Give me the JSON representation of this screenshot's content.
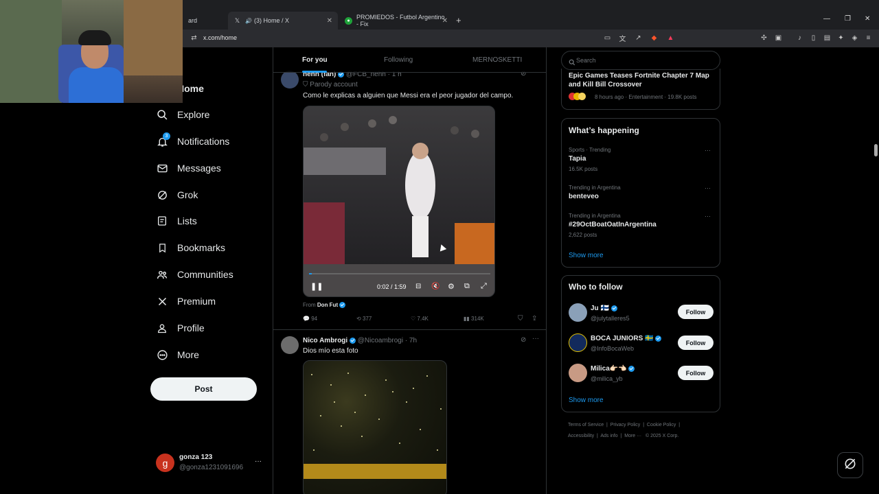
{
  "browser": {
    "tabs": [
      {
        "label": "ard",
        "icon": "page-icon"
      },
      {
        "label": "(3) Home / X",
        "icon": "x-logo-icon",
        "close": "✕"
      },
      {
        "label": "PROMIEDOS - Futbol Argentino - Fix",
        "icon": "promiedos-icon",
        "close": "✕"
      }
    ],
    "new_tab": "+",
    "url": "x.com/home"
  },
  "nav": {
    "items": [
      {
        "label": "Home",
        "icon": "home-icon"
      },
      {
        "label": "Explore",
        "icon": "search-icon"
      },
      {
        "label": "Notifications",
        "icon": "bell-icon",
        "badge": "3"
      },
      {
        "label": "Messages",
        "icon": "mail-icon"
      },
      {
        "label": "Grok",
        "icon": "grok-icon"
      },
      {
        "label": "Lists",
        "icon": "list-icon"
      },
      {
        "label": "Bookmarks",
        "icon": "bookmark-icon"
      },
      {
        "label": "Communities",
        "icon": "people-icon"
      },
      {
        "label": "Premium",
        "icon": "x-logo-icon"
      },
      {
        "label": "Profile",
        "icon": "person-icon"
      },
      {
        "label": "More",
        "icon": "more-circle-icon"
      }
    ],
    "post_label": "Post",
    "user": {
      "avatar_letter": "g",
      "name": "gonza 123",
      "handle": "@gonza1231091696",
      "menu": "···"
    }
  },
  "feed": {
    "tabs": [
      "For you",
      "Following",
      "MERNOSKETTI"
    ],
    "posts": [
      {
        "name": "nehh (fan)",
        "handle": "@FCB_nehh",
        "time": "· 1 h",
        "badge": "Parody account",
        "text": "Como le explicas a alguien que Messi era el peor jugador del campo.",
        "video_time": "0:02 / 1:59",
        "from_label": "From",
        "from_name": "Don Fut",
        "stats": {
          "replies": "94",
          "reposts": "377",
          "likes": "7.4K",
          "views": "314K"
        }
      },
      {
        "name": "Nico Ambrogi",
        "handle": "@Nicoambrogi",
        "time": "· 7h",
        "text": "Dios mío esta foto"
      }
    ]
  },
  "sidebar": {
    "search_placeholder": "Search",
    "top_news": {
      "headline": "Epic Games Teases Fortnite Chapter 7 Map and Kill Bill Crossover",
      "meta": "8 hours ago · Entertainment · 19.8K posts"
    },
    "happening": {
      "title": "What’s happening",
      "items": [
        {
          "context": "Sports · Trending",
          "topic": "Tapia",
          "count": "16.5K posts"
        },
        {
          "context": "Trending in Argentina",
          "topic": "benteveo",
          "count": ""
        },
        {
          "context": "Trending in Argentina",
          "topic": "#29OctBoatOatInArgentina",
          "count": "2,622 posts"
        }
      ],
      "more_dots": "···",
      "show_more": "Show more"
    },
    "who_to_follow": {
      "title": "Who to follow",
      "users": [
        {
          "name": "Ju 🇫🇮",
          "handle": "@julytalleres5"
        },
        {
          "name": "BOCA JUNIORS 🇸🇪",
          "handle": "@InfoBocaWeb"
        },
        {
          "name": "Milica👉🏻👈🏻",
          "handle": "@milica_yb"
        }
      ],
      "follow_label": "Follow",
      "show_more": "Show more"
    },
    "footer": {
      "row1": [
        "Terms of Service",
        "Privacy Policy",
        "Cookie Policy"
      ],
      "row2": [
        "Accessibility",
        "Ads info",
        "More ···",
        "© 2025 X Corp."
      ]
    }
  },
  "colors": {
    "accent": "#1d9bf0",
    "bg": "#000000",
    "text": "#e7e9ea",
    "muted": "#71767b",
    "border": "#2f3336"
  }
}
